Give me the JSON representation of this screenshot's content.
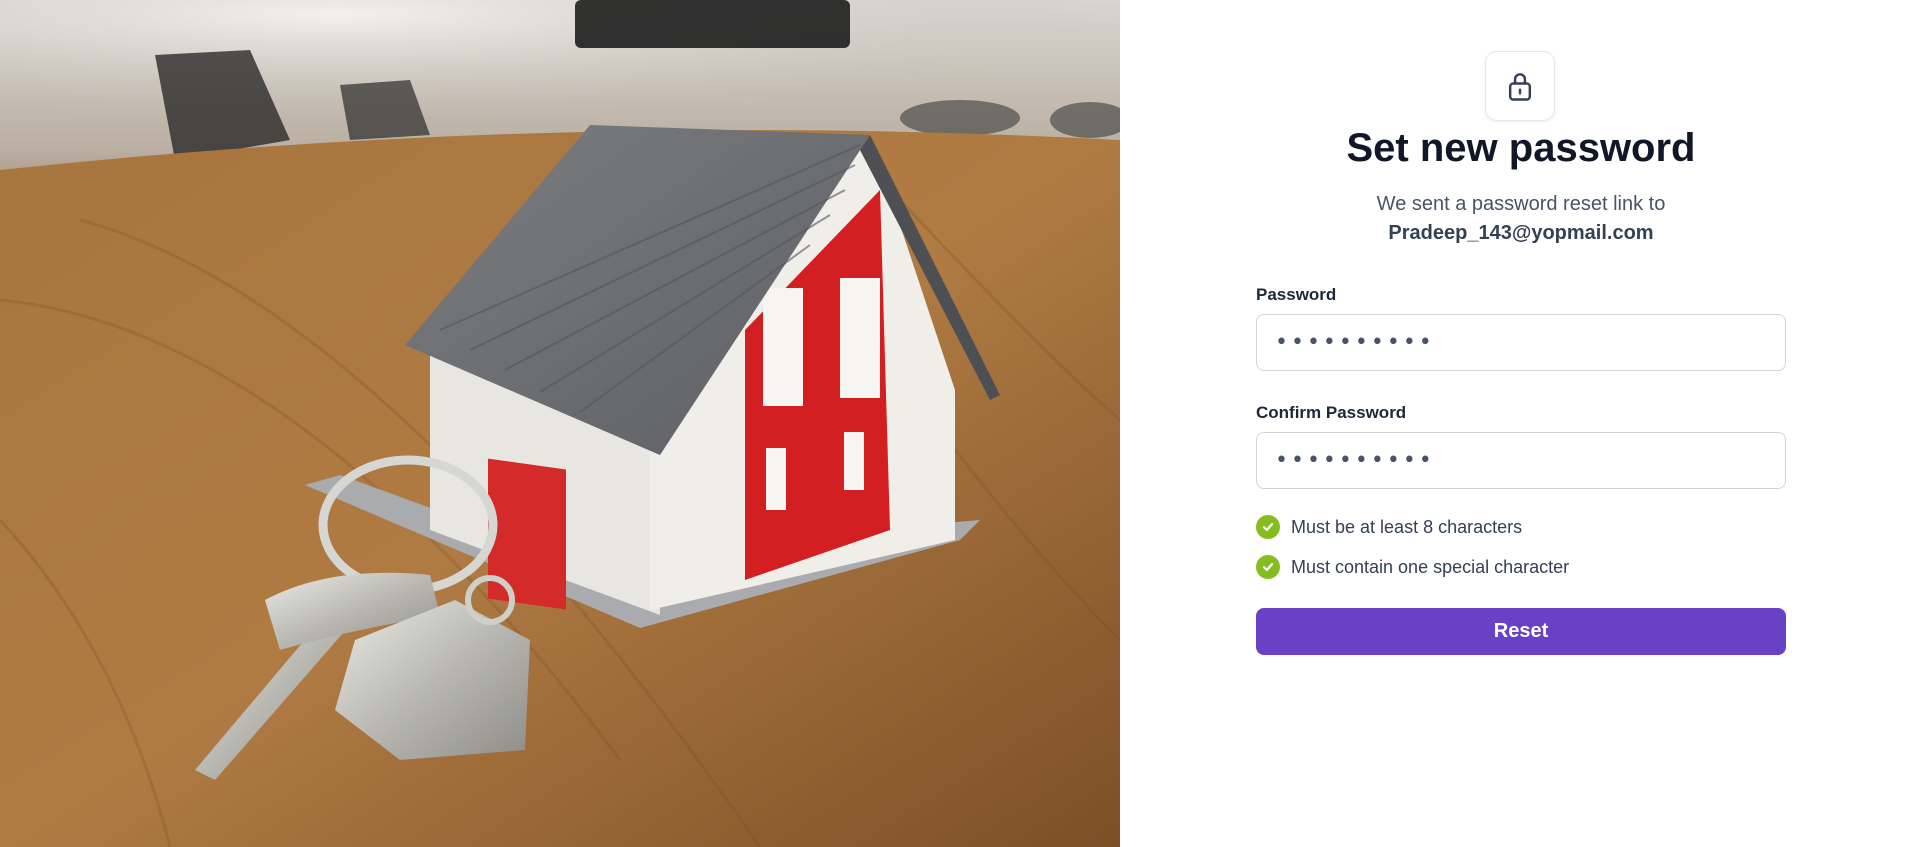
{
  "hero": {
    "image": "house-keychain-photo"
  },
  "form": {
    "icon": "lock-icon",
    "title": "Set new password",
    "subtitle": "We sent a password reset link to",
    "email": "Pradeep_143@yopmail.com",
    "password": {
      "label": "Password",
      "value": "••••••••••"
    },
    "confirm_password": {
      "label": "Confirm Password",
      "value": "••••••••••"
    },
    "rules": [
      {
        "text": "Must be at least 8 characters",
        "icon": "check-icon",
        "satisfied": true
      },
      {
        "text": "Must contain one special character",
        "icon": "check-icon",
        "satisfied": true
      }
    ],
    "submit_label": "Reset",
    "colors": {
      "primary": "#6941c6",
      "success": "#84bd1d"
    }
  }
}
